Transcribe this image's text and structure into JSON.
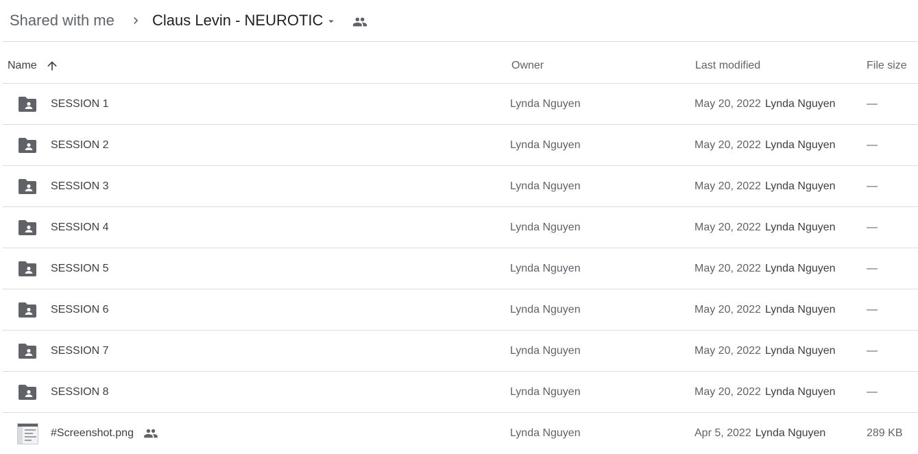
{
  "breadcrumb": {
    "root": "Shared with me",
    "current": "Claus Levin - NEUROTIC"
  },
  "icons": {
    "separator": "chevron-right-icon",
    "dropdown": "arrow-drop-down-icon",
    "shared": "people-icon",
    "folder": "shared-folder-icon",
    "sort": "arrow-upward-icon"
  },
  "table": {
    "headers": {
      "name": "Name",
      "owner": "Owner",
      "last_modified": "Last modified",
      "file_size": "File size"
    },
    "rows": [
      {
        "name": "SESSION 1",
        "owner": "Lynda Nguyen",
        "modified_date": "May 20, 2022",
        "modified_by": "Lynda Nguyen",
        "size": "—"
      },
      {
        "name": "SESSION 2",
        "owner": "Lynda Nguyen",
        "modified_date": "May 20, 2022",
        "modified_by": "Lynda Nguyen",
        "size": "—"
      },
      {
        "name": "SESSION 3",
        "owner": "Lynda Nguyen",
        "modified_date": "May 20, 2022",
        "modified_by": "Lynda Nguyen",
        "size": "—"
      },
      {
        "name": "SESSION 4",
        "owner": "Lynda Nguyen",
        "modified_date": "May 20, 2022",
        "modified_by": "Lynda Nguyen",
        "size": "—"
      },
      {
        "name": "SESSION 5",
        "owner": "Lynda Nguyen",
        "modified_date": "May 20, 2022",
        "modified_by": "Lynda Nguyen",
        "size": "—"
      },
      {
        "name": "SESSION 6",
        "owner": "Lynda Nguyen",
        "modified_date": "May 20, 2022",
        "modified_by": "Lynda Nguyen",
        "size": "—"
      },
      {
        "name": "SESSION 7",
        "owner": "Lynda Nguyen",
        "modified_date": "May 20, 2022",
        "modified_by": "Lynda Nguyen",
        "size": "—"
      },
      {
        "name": "SESSION 8",
        "owner": "Lynda Nguyen",
        "modified_date": "May 20, 2022",
        "modified_by": "Lynda Nguyen",
        "size": "—"
      },
      {
        "name": "#Screenshot.png",
        "owner": "Lynda Nguyen",
        "modified_date": "Apr 5, 2022",
        "modified_by": "Lynda Nguyen",
        "size": "289 KB"
      }
    ]
  },
  "colors": {
    "icon": "#5f6368",
    "divider": "#dadce0",
    "text_primary": "#3c4043",
    "text_secondary": "#5f6368"
  }
}
